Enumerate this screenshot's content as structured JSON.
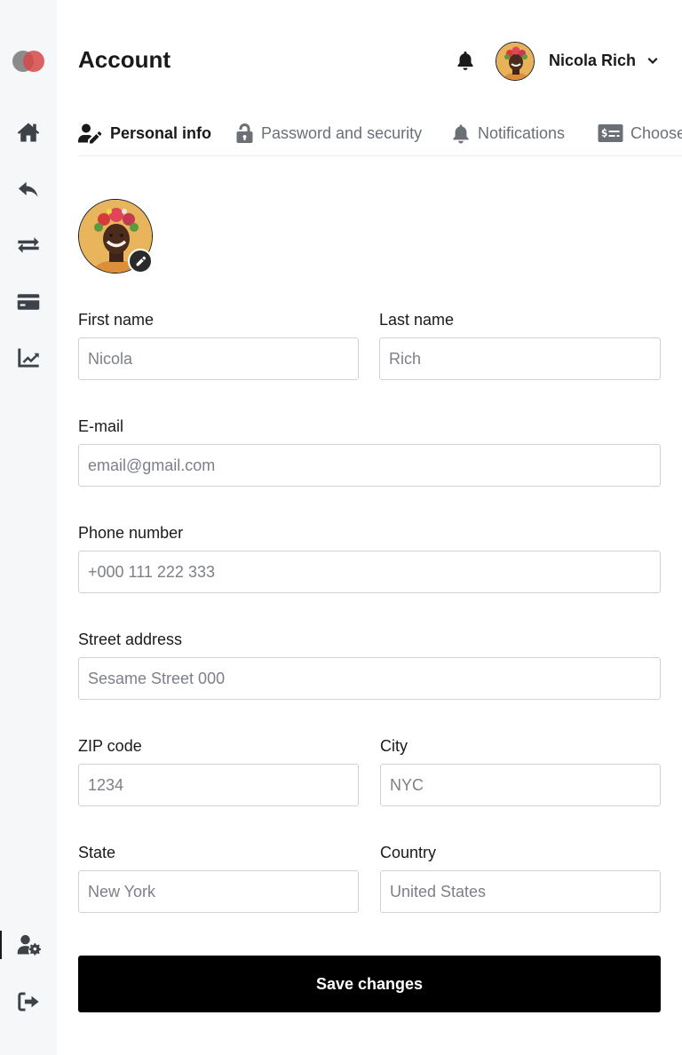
{
  "header": {
    "title": "Account",
    "user_name": "Nicola Rich"
  },
  "tabs": [
    {
      "label": "Personal info",
      "icon": "user-edit-icon",
      "active": true
    },
    {
      "label": "Password and security",
      "icon": "unlock-icon",
      "active": false
    },
    {
      "label": "Notifications",
      "icon": "bell-icon",
      "active": false
    },
    {
      "label": "Choose",
      "icon": "money-check-icon",
      "active": false
    }
  ],
  "sidebar": {
    "items": [
      {
        "icon": "home-icon"
      },
      {
        "icon": "reply-icon"
      },
      {
        "icon": "exchange-icon"
      },
      {
        "icon": "credit-card-icon"
      },
      {
        "icon": "chart-line-icon"
      }
    ],
    "bottom": [
      {
        "icon": "user-settings-icon",
        "active": true
      },
      {
        "icon": "sign-out-icon"
      }
    ]
  },
  "form": {
    "first_name": {
      "label": "First name",
      "placeholder": "Nicola"
    },
    "last_name": {
      "label": "Last name",
      "placeholder": "Rich"
    },
    "email": {
      "label": "E-mail",
      "placeholder": "email@gmail.com"
    },
    "phone": {
      "label": "Phone number",
      "placeholder": "+000 111 222 333"
    },
    "street": {
      "label": "Street address",
      "placeholder": "Sesame Street 000"
    },
    "zip": {
      "label": "ZIP code",
      "placeholder": "1234"
    },
    "city": {
      "label": "City",
      "placeholder": "NYC"
    },
    "state": {
      "label": "State",
      "placeholder": "New York"
    },
    "country": {
      "label": "Country",
      "placeholder": "United States"
    },
    "save_label": "Save changes"
  },
  "colors": {
    "sidebar_bg": "#f6f7f9",
    "primary": "#000000",
    "text": "#1a1a1a",
    "muted": "#6b6f76",
    "border": "#cfd2d6",
    "logo_gray": "#8b8b8b",
    "logo_red": "#d64848"
  }
}
